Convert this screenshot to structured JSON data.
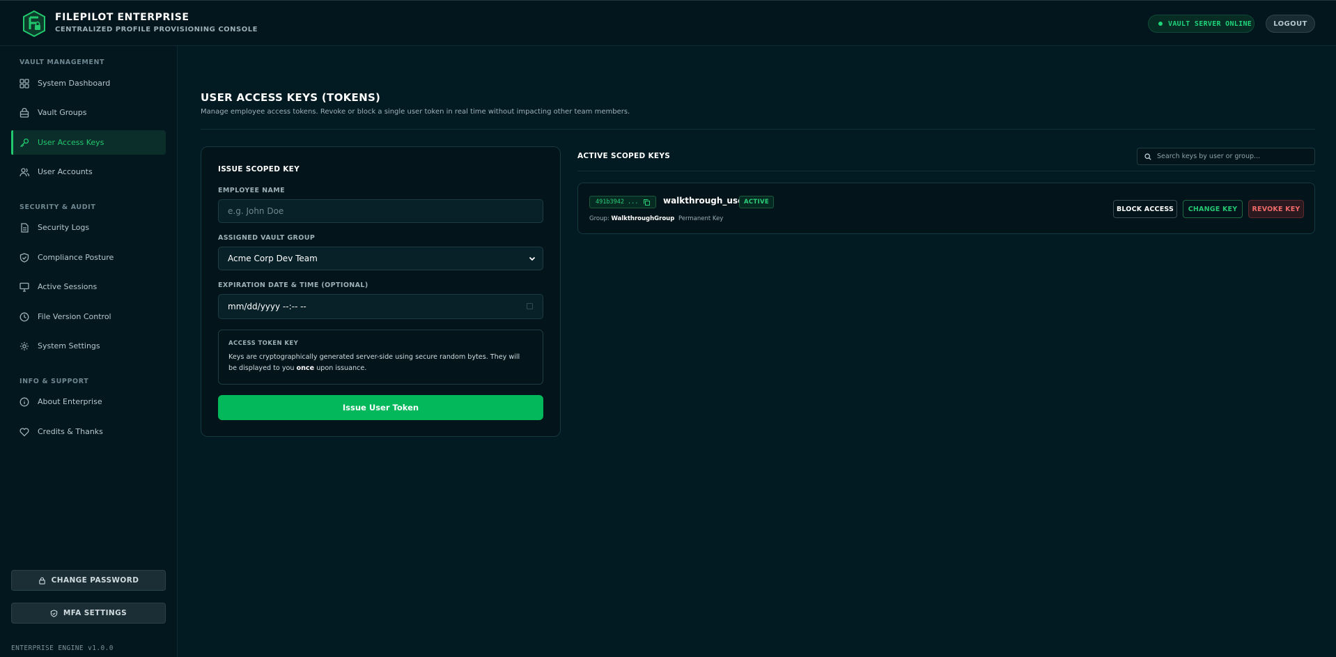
{
  "header": {
    "title": "FILEPILOT ENTERPRISE",
    "subtitle": "CENTRALIZED PROFILE PROVISIONING CONSOLE",
    "status": "VAULT SERVER ONLINE",
    "logout_label": "LOGOUT"
  },
  "sidebar": {
    "sections": [
      {
        "label": "VAULT MANAGEMENT"
      },
      {
        "label": "SECURITY & AUDIT"
      },
      {
        "label": "INFO & SUPPORT"
      }
    ],
    "items": [
      {
        "label": "System Dashboard",
        "icon": "grid-icon"
      },
      {
        "label": "Vault Groups",
        "icon": "vault-icon"
      },
      {
        "label": "User Access Keys",
        "icon": "key-icon",
        "active": true
      },
      {
        "label": "User Accounts",
        "icon": "users-icon"
      },
      {
        "label": "Security Logs",
        "icon": "document-icon"
      },
      {
        "label": "Compliance Posture",
        "icon": "shield-check-icon"
      },
      {
        "label": "Active Sessions",
        "icon": "monitor-icon"
      },
      {
        "label": "File Version Control",
        "icon": "clock-icon"
      },
      {
        "label": "System Settings",
        "icon": "gear-icon"
      },
      {
        "label": "About Enterprise",
        "icon": "info-icon"
      },
      {
        "label": "Credits & Thanks",
        "icon": "heart-icon"
      }
    ],
    "change_password_label": "CHANGE PASSWORD",
    "mfa_label": "MFA SETTINGS",
    "engine_version": "ENTERPRISE ENGINE v1.0.0"
  },
  "main": {
    "title": "USER ACCESS KEYS (TOKENS)",
    "description": "Manage employee access tokens. Revoke or block a single user token in real time without impacting other team members."
  },
  "issue_form": {
    "title": "ISSUE SCOPED KEY",
    "employee_label": "EMPLOYEE NAME",
    "employee_placeholder": "e.g. John Doe",
    "group_label": "ASSIGNED VAULT GROUP",
    "group_value": "Acme Corp Dev Team",
    "expiration_label": "EXPIRATION DATE & TIME (OPTIONAL)",
    "expiration_placeholder": "mm/dd/yyyy --:-- --",
    "info_label": "ACCESS TOKEN KEY",
    "info_text_before": "Keys are cryptographically generated server-side using secure random bytes. They will be displayed to you ",
    "info_text_bold": "once",
    "info_text_after": " upon issuance.",
    "submit_label": "Issue User Token"
  },
  "keys": {
    "title": "ACTIVE SCOPED KEYS",
    "search_placeholder": "Search keys by user or group...",
    "rows": [
      {
        "key_prefix": "491b3942 ...",
        "user": "walkthrough_user",
        "status": "ACTIVE",
        "group_label": "Group:",
        "group": "WalkthroughGroup",
        "expiry": "Permanent Key",
        "block_label": "BLOCK ACCESS",
        "change_label": "CHANGE KEY",
        "revoke_label": "REVOKE KEY"
      }
    ]
  },
  "colors": {
    "accent": "#03b85a",
    "background": "#021a22",
    "danger": "#f06a6a"
  }
}
